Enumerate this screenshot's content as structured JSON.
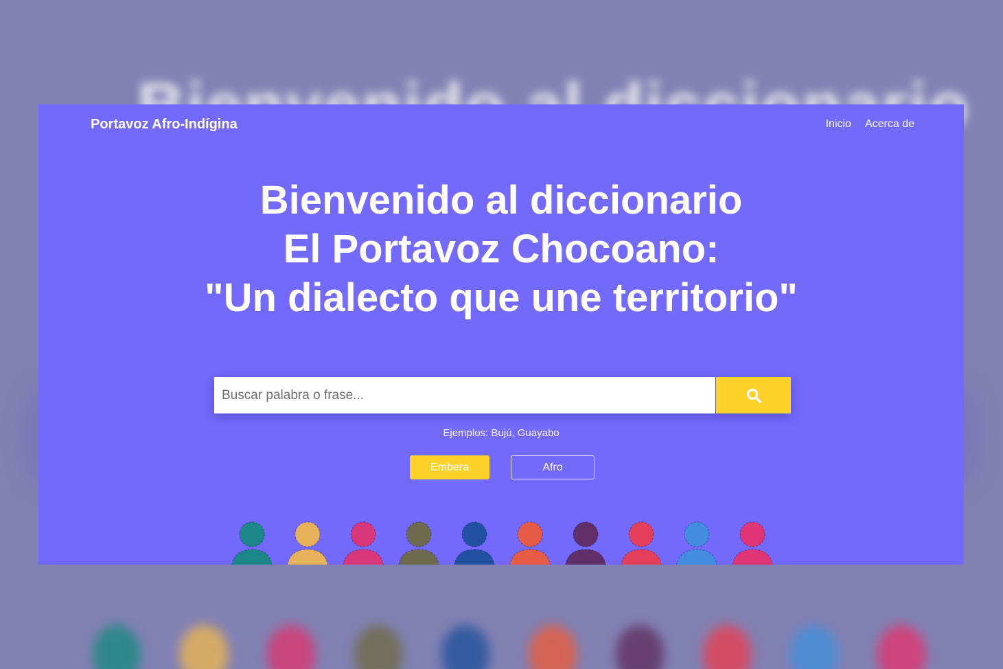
{
  "header": {
    "brand": "Portavoz Afro-Indígina",
    "nav": [
      {
        "label": "Inicio"
      },
      {
        "label": "Acerca de"
      }
    ]
  },
  "hero": {
    "title_lines": [
      "Bienvenido al diccionario",
      "El Portavoz Chocoano:",
      "\"Un dialecto que une territorio\""
    ]
  },
  "search": {
    "value": "",
    "placeholder": "Buscar palabra o frase...",
    "button_icon": "search-icon"
  },
  "examples": "Ejemplos: Bujú, Guayabo",
  "language_buttons": {
    "embera": "Embera",
    "afro": "Afro"
  },
  "colors": {
    "card_bg": "#7369fd",
    "accent": "#fdd22a",
    "backdrop": "#8281b3"
  },
  "figure_colors": [
    "#138a7e",
    "#f2b94d",
    "#e0326c",
    "#6d6a3f",
    "#1b4f9a",
    "#f05a35",
    "#5e2a5c",
    "#ee3c4c",
    "#3f8fdc",
    "#e8306a"
  ],
  "backdrop": {
    "title_blur": "Bienvenido al diccionario"
  }
}
